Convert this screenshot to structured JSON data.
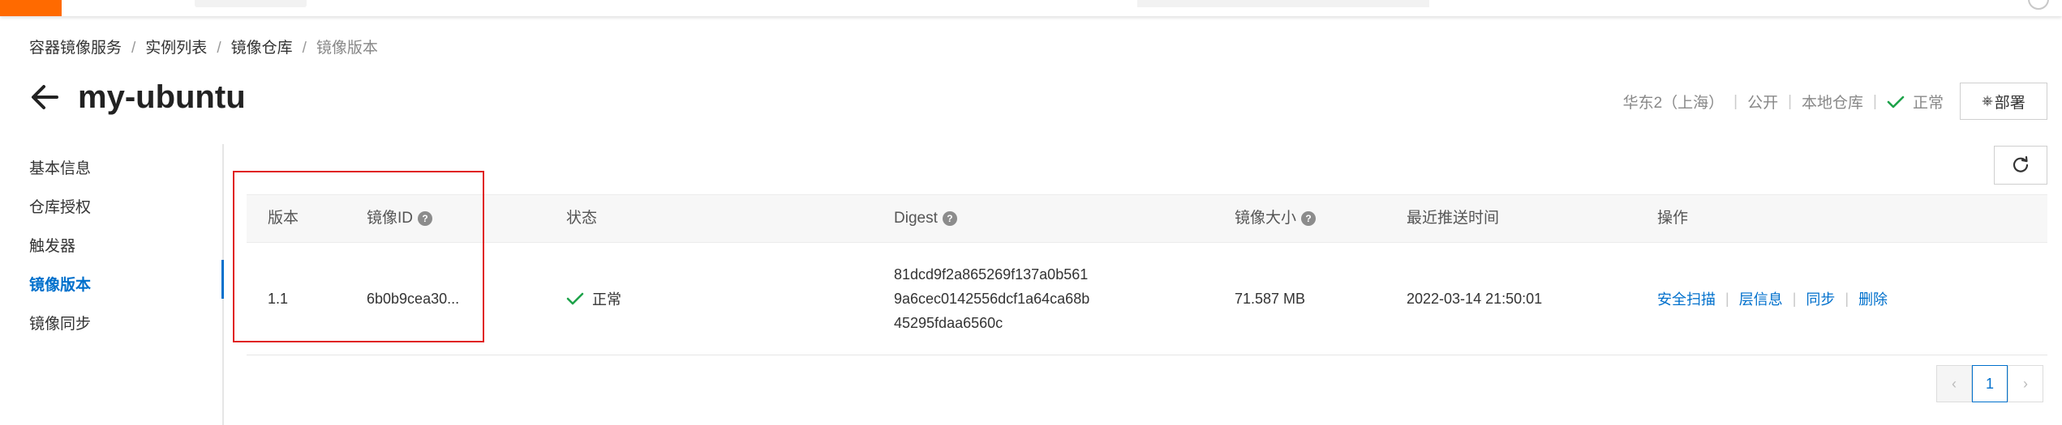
{
  "breadcrumb": {
    "items": [
      "容器镜像服务",
      "实例列表",
      "镜像仓库"
    ],
    "current": "镜像版本",
    "separator": "/"
  },
  "header": {
    "title": "my-ubuntu",
    "region": "华东2（上海）",
    "visibility": "公开",
    "repo_type": "本地仓库",
    "status": "正常",
    "deploy_label": "部署",
    "deploy_icon": "deploy-icon",
    "back_icon": "arrow-left-icon"
  },
  "sidebar": {
    "items": [
      {
        "label": "基本信息"
      },
      {
        "label": "仓库授权"
      },
      {
        "label": "触发器"
      },
      {
        "label": "镜像版本",
        "active": true
      },
      {
        "label": "镜像同步"
      }
    ]
  },
  "toolbar": {
    "refresh_icon": "refresh-icon"
  },
  "table": {
    "columns": {
      "version": "版本",
      "image_id": "镜像ID",
      "status": "状态",
      "digest": "Digest",
      "size": "镜像大小",
      "pushed": "最近推送时间",
      "actions": "操作"
    },
    "help_glyph": "?",
    "rows": [
      {
        "version": "1.1",
        "image_id": "6b0b9cea30...",
        "status": "正常",
        "digest_lines": [
          "81dcd9f2a865269f137a0b561",
          "9a6cec0142556dcf1a64ca68b",
          "45295fdaa6560c"
        ],
        "size": "71.587 MB",
        "pushed": "2022-03-14 21:50:01",
        "actions": [
          "安全扫描",
          "层信息",
          "同步",
          "删除"
        ]
      }
    ]
  },
  "pagination": {
    "prev": "‹",
    "current": "1",
    "next": "›"
  },
  "colors": {
    "accent": "#0070cc",
    "success": "#1ea34a",
    "brand": "#ff6a00",
    "highlight": "#e02020"
  }
}
